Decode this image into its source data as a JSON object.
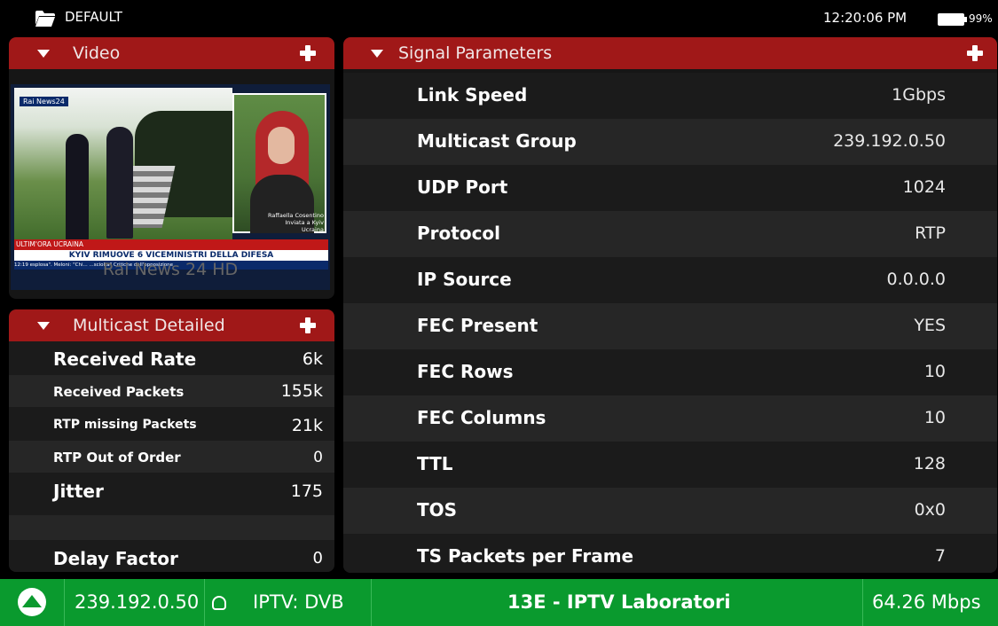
{
  "statusbar": {
    "profile": "DEFAULT",
    "time": "12:20:06 PM",
    "battery": "99%",
    "battery_level": 0.99
  },
  "video": {
    "title": "Video",
    "overlay_label": "Rai News 24 HD",
    "frame_text": {
      "channel": "Rai News24",
      "reporter": "Raffaella Cosentino",
      "reporter_location": "Inviata a Kyiv",
      "reporter_country": "Ucraina",
      "breaking": "ULTIM'ORA UCRAINA",
      "headline": "KYIV RIMUOVE 6 VICEMINISTRI DELLA DIFESA",
      "ticker": "12:19  esplosa\". Meloni: \"Chi... ...sciolta\"  Critiche dall'opposizione"
    }
  },
  "multicast": {
    "title": "Multicast Detailed",
    "rows": [
      {
        "label": "Received Rate",
        "value": "6k"
      },
      {
        "label": "Received Packets",
        "value": "155k"
      },
      {
        "label": "RTP missing Packets",
        "value": "21k"
      },
      {
        "label": "RTP Out of Order",
        "value": "0"
      },
      {
        "label": "Jitter",
        "value": "175"
      },
      {
        "label": "",
        "value": ""
      },
      {
        "label": "Delay Factor",
        "value": "0"
      }
    ]
  },
  "signal": {
    "title": "Signal Parameters",
    "rows": [
      {
        "label": "Link Speed",
        "value": "1Gbps"
      },
      {
        "label": "Multicast Group",
        "value": "239.192.0.50"
      },
      {
        "label": "UDP Port",
        "value": "1024"
      },
      {
        "label": "Protocol",
        "value": "RTP"
      },
      {
        "label": "IP Source",
        "value": "0.0.0.0"
      },
      {
        "label": "FEC Present",
        "value": "YES"
      },
      {
        "label": "FEC Rows",
        "value": "10"
      },
      {
        "label": "FEC Columns",
        "value": "10"
      },
      {
        "label": "TTL",
        "value": "128"
      },
      {
        "label": "TOS",
        "value": "0x0"
      },
      {
        "label": "TS Packets per Frame",
        "value": "7"
      }
    ]
  },
  "bottombar": {
    "address": "239.192.0.50",
    "mode": "IPTV: DVB",
    "channel": "13E - IPTV Laboratori",
    "bitrate": "64.26 Mbps"
  },
  "colors": {
    "header_red": "#a01818",
    "status_green": "#0a9a2e",
    "row_dark": "#1b1b1b",
    "row_light": "#262626"
  },
  "icons": {
    "folder": "folder-icon",
    "battery": "battery-icon",
    "collapse": "triangle-down-icon",
    "add": "plus-icon",
    "logo": "app-logo-icon",
    "chat": "chat-bubble-icon"
  }
}
